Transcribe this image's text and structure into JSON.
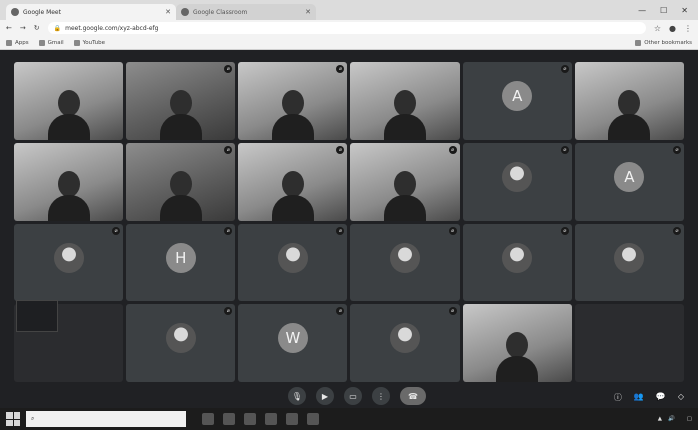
{
  "browser": {
    "tabs": [
      {
        "label": "Google Meet",
        "active": true
      },
      {
        "label": "Google Classroom",
        "active": false
      }
    ],
    "url": "meet.google.com/xyz-abcd-efg",
    "bookmarks": [
      "Apps",
      "Gmail",
      "YouTube"
    ],
    "bookmarks_right": "Other bookmarks"
  },
  "tiles": [
    {
      "type": "video",
      "name": "",
      "muted": false,
      "light": true
    },
    {
      "type": "video",
      "name": "",
      "muted": true,
      "light": false
    },
    {
      "type": "video",
      "name": "",
      "muted": true,
      "light": true
    },
    {
      "type": "video",
      "name": "",
      "muted": false,
      "light": true
    },
    {
      "type": "avatar",
      "letter": "A",
      "name": "",
      "muted": true
    },
    {
      "type": "video",
      "name": "",
      "muted": false,
      "light": true
    },
    {
      "type": "video",
      "name": "",
      "muted": false,
      "light": true
    },
    {
      "type": "video",
      "name": "",
      "muted": true,
      "light": false
    },
    {
      "type": "video",
      "name": "",
      "muted": true,
      "light": true
    },
    {
      "type": "video",
      "name": "",
      "muted": true,
      "light": true
    },
    {
      "type": "photo",
      "name": "",
      "muted": true
    },
    {
      "type": "avatar",
      "letter": "A",
      "name": "",
      "muted": true
    },
    {
      "type": "photo",
      "name": "",
      "muted": true
    },
    {
      "type": "avatar",
      "letter": "H",
      "name": "",
      "muted": true
    },
    {
      "type": "photo",
      "name": "",
      "muted": true
    },
    {
      "type": "photo",
      "name": "",
      "muted": true
    },
    {
      "type": "photo",
      "name": "",
      "muted": true
    },
    {
      "type": "photo",
      "name": "",
      "muted": true
    },
    {
      "type": "empty",
      "name": "",
      "muted": false
    },
    {
      "type": "photo",
      "name": "",
      "muted": true
    },
    {
      "type": "avatar",
      "letter": "W",
      "name": "",
      "muted": true
    },
    {
      "type": "photo",
      "name": "",
      "muted": true
    },
    {
      "type": "video",
      "name": "",
      "muted": false,
      "light": true
    },
    {
      "type": "empty",
      "name": "",
      "muted": false
    }
  ],
  "controls": {
    "time": "",
    "meeting_code": ""
  },
  "taskbar": {
    "search_placeholder": "",
    "clock_time": "",
    "clock_date": ""
  },
  "colors": {
    "meet_bg": "#202124",
    "tile_bg": "#3c4043"
  }
}
